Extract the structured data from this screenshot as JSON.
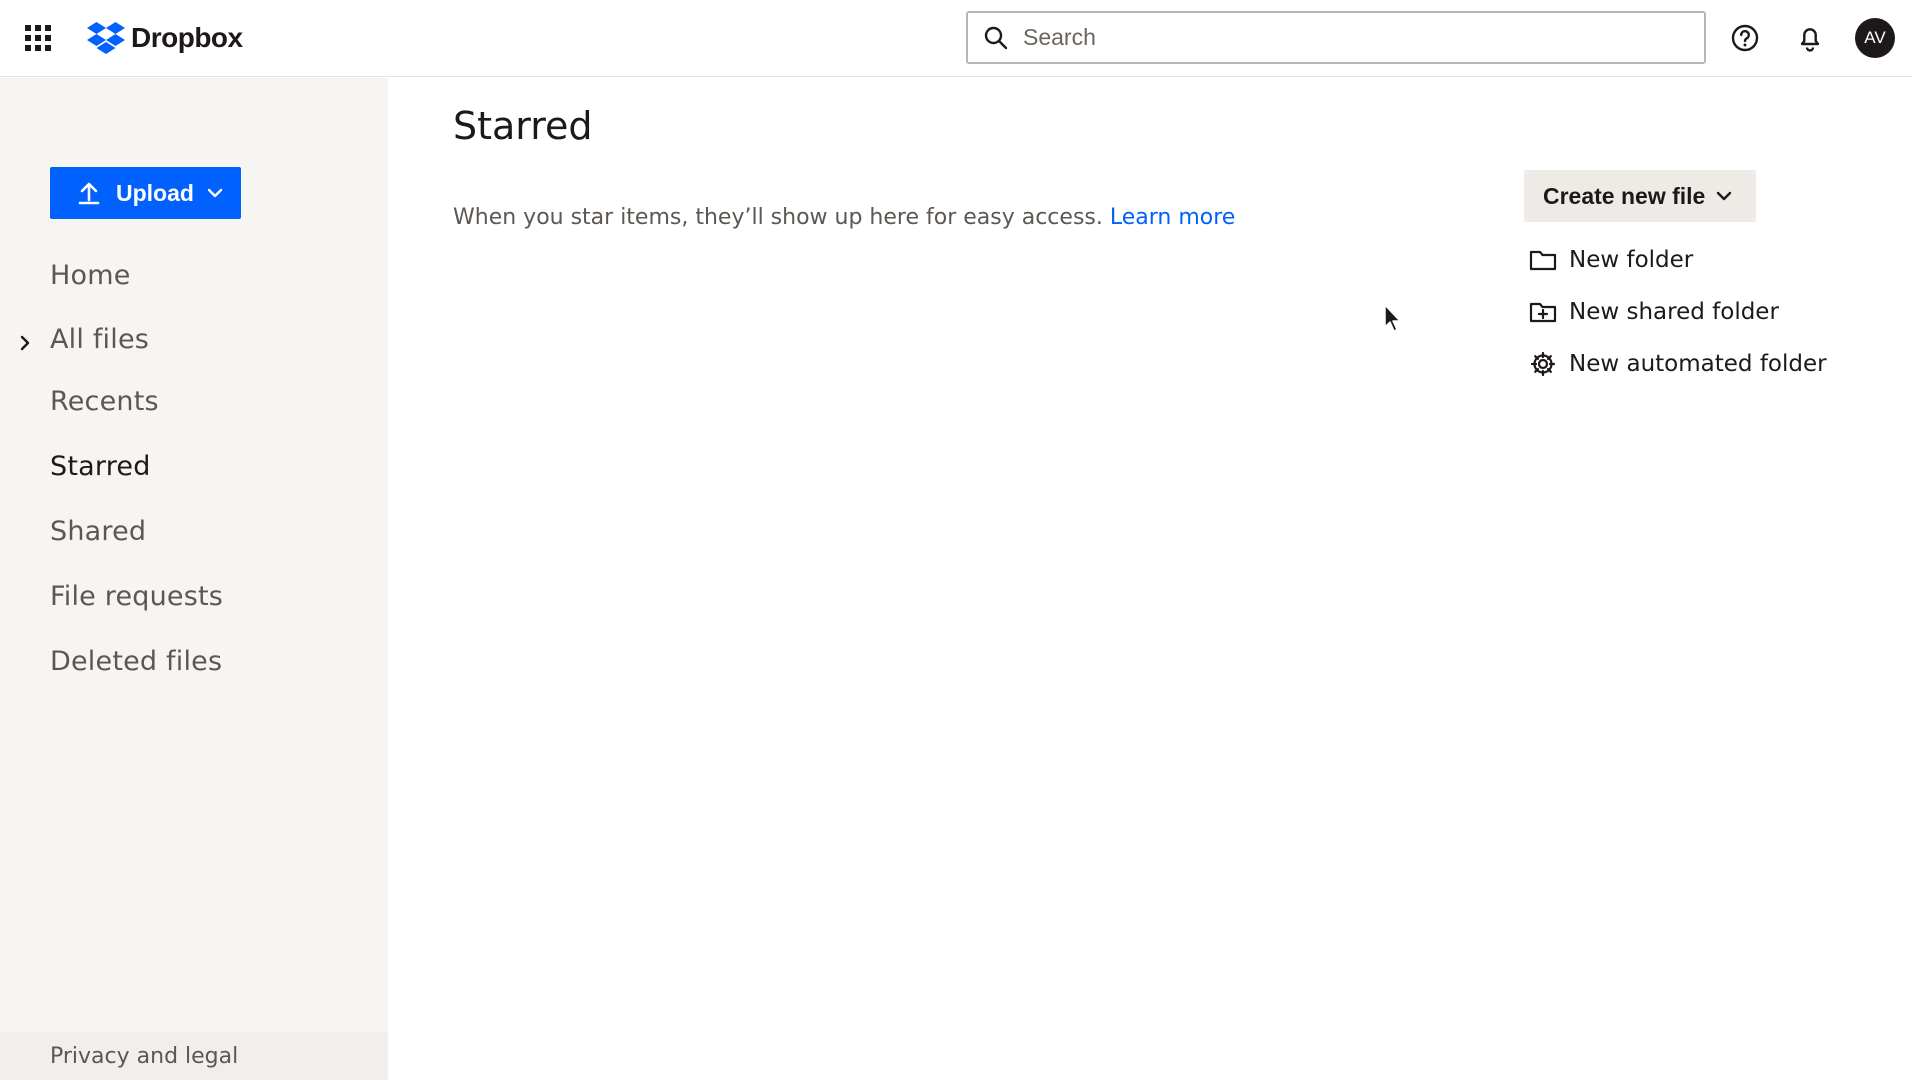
{
  "header": {
    "logo_text": "Dropbox",
    "search": {
      "placeholder": "Search",
      "value": ""
    },
    "avatar_initials": "AV",
    "icons": [
      "apps-grid-icon",
      "dropbox-logo-icon",
      "search-icon",
      "help-icon",
      "bell-icon"
    ]
  },
  "sidebar": {
    "upload_label": "Upload",
    "items": [
      {
        "label": "Home",
        "active": false
      },
      {
        "label": "All files",
        "active": false,
        "expandable": true
      },
      {
        "label": "Recents",
        "active": false
      },
      {
        "label": "Starred",
        "active": true
      },
      {
        "label": "Shared",
        "active": false
      },
      {
        "label": "File requests",
        "active": false
      },
      {
        "label": "Deleted files",
        "active": false
      }
    ],
    "footer_label": "Privacy and legal"
  },
  "main": {
    "title": "Starred",
    "empty_message": "When you star items, they’ll show up here for easy access.",
    "learn_more": "Learn more",
    "create_label": "Create new file",
    "actions": [
      {
        "label": "New folder",
        "icon": "folder-icon"
      },
      {
        "label": "New shared folder",
        "icon": "shared-folder-icon"
      },
      {
        "label": "New automated folder",
        "icon": "automated-folder-icon"
      }
    ]
  },
  "colors": {
    "accent": "#0061fe",
    "sidebar_bg": "#f7f5f2",
    "text": "#1e1919",
    "muted_text": "#5c5752"
  }
}
